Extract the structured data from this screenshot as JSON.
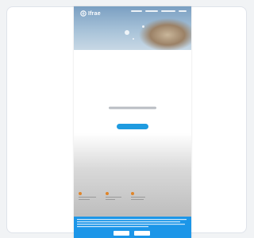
{
  "app": {
    "brand": "Ifrae"
  },
  "nav": {
    "items": [
      "",
      "",
      "",
      ""
    ]
  },
  "hero": {
    "headline": "",
    "cta_label": ""
  },
  "features": [
    {
      "title": ""
    },
    {
      "title": ""
    },
    {
      "title": ""
    }
  ],
  "cookie": {
    "text": "",
    "accept_label": "",
    "settings_label": ""
  },
  "colors": {
    "accent": "#1f9be0",
    "cookie_bar": "#1c96e8",
    "feature_icon": "#e0852a"
  },
  "icons": [
    "logo-icon"
  ]
}
